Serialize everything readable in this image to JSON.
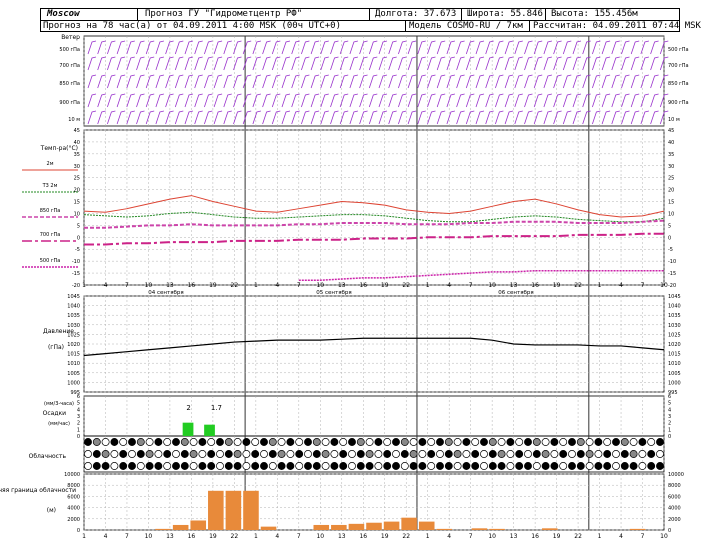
{
  "header": {
    "city": "Moscow",
    "source": "Прогноз ГУ \"Гидрометцентр РФ\"",
    "longitude": "Долгота: 37.673",
    "latitude": "Широта: 55.846",
    "altitude": "Высота: 155.456м",
    "forecast_info": "Прогноз на 78 час(а) от 04.09.2011 4:00 MSK (00ч UTC+0)",
    "model": "Модель COSMO-RU / 7км",
    "computed": "Рассчитан: 04.09.2011 07:44 MSK"
  },
  "labels": {
    "wind_title": "Ветер",
    "wind_levels": [
      "500 гПа",
      "700 гПа",
      "850 гПа",
      "900 гПа",
      "10 м"
    ],
    "wind_right_levels": [
      "500 гПа",
      "700 гПа",
      "850 гПа",
      "900 гПа",
      "10 м"
    ],
    "temp_title": "Темп-ра(°C)",
    "temp_series": [
      "2м",
      "Т3 2м",
      "850 гПа",
      "700 гПа",
      "500 гПа"
    ],
    "pressure_title": "Давление",
    "pressure_unit": "(гПа)",
    "precip_unit": "(мм/3-часа)",
    "precip_title": "Осадки",
    "precip_unit2": "(мм/час)",
    "cloud_title": "Облачность",
    "cloudbase_title": "Нижняя граница облачности",
    "cloudbase_unit": "(м)",
    "precip_values": [
      "2",
      "1.7"
    ],
    "day_labels": [
      "04 сентября",
      "05 сентября",
      "06 сентября"
    ]
  },
  "colors": {
    "temp2m": "#dd4433",
    "dew": "#228822",
    "t850": "#cc44aa",
    "t700": "#cc2288",
    "t500": "#cc22aa",
    "wind": "#9933cc",
    "precip": "#22cc22",
    "cloudbase": "#e88a3a",
    "grid": "#b0b0b0"
  },
  "chart_data": [
    {
      "type": "line",
      "title": "Темп-ра(°C)",
      "x": [
        "1",
        "4",
        "7",
        "10",
        "13",
        "16",
        "19",
        "22",
        "1",
        "4",
        "7",
        "10",
        "13",
        "16",
        "19",
        "22",
        "1",
        "4",
        "7",
        "10",
        "13",
        "16",
        "19",
        "22",
        "1",
        "4",
        "7",
        "10"
      ],
      "ylim": [
        -20,
        45
      ],
      "yticks": [
        45,
        40,
        35,
        30,
        25,
        20,
        15,
        10,
        5,
        0,
        -5,
        -10,
        -15,
        -20
      ],
      "series": [
        {
          "name": "2м",
          "values": [
            11,
            10.5,
            12,
            14,
            16,
            17.5,
            15,
            13,
            11,
            10.5,
            12,
            13.5,
            15,
            14.5,
            13.5,
            11.5,
            10.5,
            10,
            11,
            13,
            15,
            16,
            14,
            11.5,
            9.5,
            8.5,
            9,
            11
          ]
        },
        {
          "name": "Т3 2м",
          "values": [
            9.5,
            9,
            8.5,
            9,
            10,
            10.5,
            9.5,
            8.5,
            8,
            8,
            8.5,
            9,
            9.5,
            9.5,
            9,
            8,
            7,
            6.5,
            6.5,
            7.5,
            8.5,
            9,
            8.5,
            7.5,
            7,
            6.5,
            6.5,
            8
          ]
        },
        {
          "name": "850 гПа",
          "values": [
            4,
            4,
            4.5,
            5,
            5,
            5.5,
            5,
            5,
            5,
            5,
            5.5,
            5.5,
            6,
            6,
            6,
            5.5,
            5.5,
            5.5,
            6,
            6,
            6.5,
            6.5,
            6.5,
            6,
            6,
            6,
            6.5,
            7
          ]
        },
        {
          "name": "700 гПа",
          "values": [
            -3,
            -3,
            -2.5,
            -2.5,
            -2,
            -2,
            -2,
            -1.5,
            -1.5,
            -1.5,
            -1,
            -1,
            -1,
            -0.5,
            -0.5,
            -0.5,
            0,
            0,
            0,
            0.5,
            0.5,
            0.5,
            0.5,
            1,
            1,
            1,
            1.5,
            1.5
          ]
        },
        {
          "name": "500 гПа",
          "values": [
            null,
            null,
            null,
            null,
            null,
            null,
            null,
            null,
            null,
            null,
            -18,
            -18,
            -17.5,
            -17,
            -17,
            -16.5,
            -16,
            -15.5,
            -15,
            -14.5,
            -14.5,
            -14,
            -14,
            -14,
            -14,
            -14,
            -14,
            -14
          ]
        }
      ]
    },
    {
      "type": "line",
      "title": "Давление",
      "ylabel": "(гПа)",
      "ylim": [
        995,
        1045
      ],
      "yticks": [
        1045,
        1040,
        1035,
        1030,
        1025,
        1020,
        1015,
        1010,
        1005,
        1000,
        995
      ],
      "series": [
        {
          "name": "Давление",
          "values": [
            1014,
            1015,
            1016,
            1017,
            1018,
            1019,
            1020,
            1021,
            1021.5,
            1022,
            1022,
            1022,
            1022.5,
            1023,
            1023,
            1023,
            1023,
            1023,
            1023,
            1022,
            1020,
            1019.5,
            1019.5,
            1019.5,
            1019,
            1019,
            1018,
            1017
          ]
        }
      ]
    },
    {
      "type": "bar",
      "title": "Осадки",
      "ylabel": "(мм/час)",
      "ylim": [
        0,
        6
      ],
      "yticks": [
        6,
        5,
        4,
        3,
        2,
        1,
        0
      ],
      "values": [
        0,
        0,
        0,
        0,
        0,
        2,
        1.7,
        0,
        0,
        0,
        0,
        0,
        0,
        0,
        0,
        0,
        0,
        0,
        0,
        0,
        0,
        0,
        0,
        0,
        0,
        0,
        0,
        0
      ]
    },
    {
      "type": "bar",
      "title": "Нижняя граница облачности",
      "ylabel": "(м)",
      "ylim": [
        0,
        10000
      ],
      "yticks": [
        10000,
        8000,
        6000,
        4000,
        2000,
        0
      ],
      "values": [
        0,
        0,
        0,
        0,
        200,
        900,
        1700,
        7000,
        7000,
        7000,
        600,
        0,
        0,
        900,
        900,
        1100,
        1300,
        1500,
        2200,
        1500,
        200,
        0,
        300,
        200,
        0,
        0,
        300,
        0,
        0,
        0,
        0,
        200,
        0
      ]
    }
  ]
}
